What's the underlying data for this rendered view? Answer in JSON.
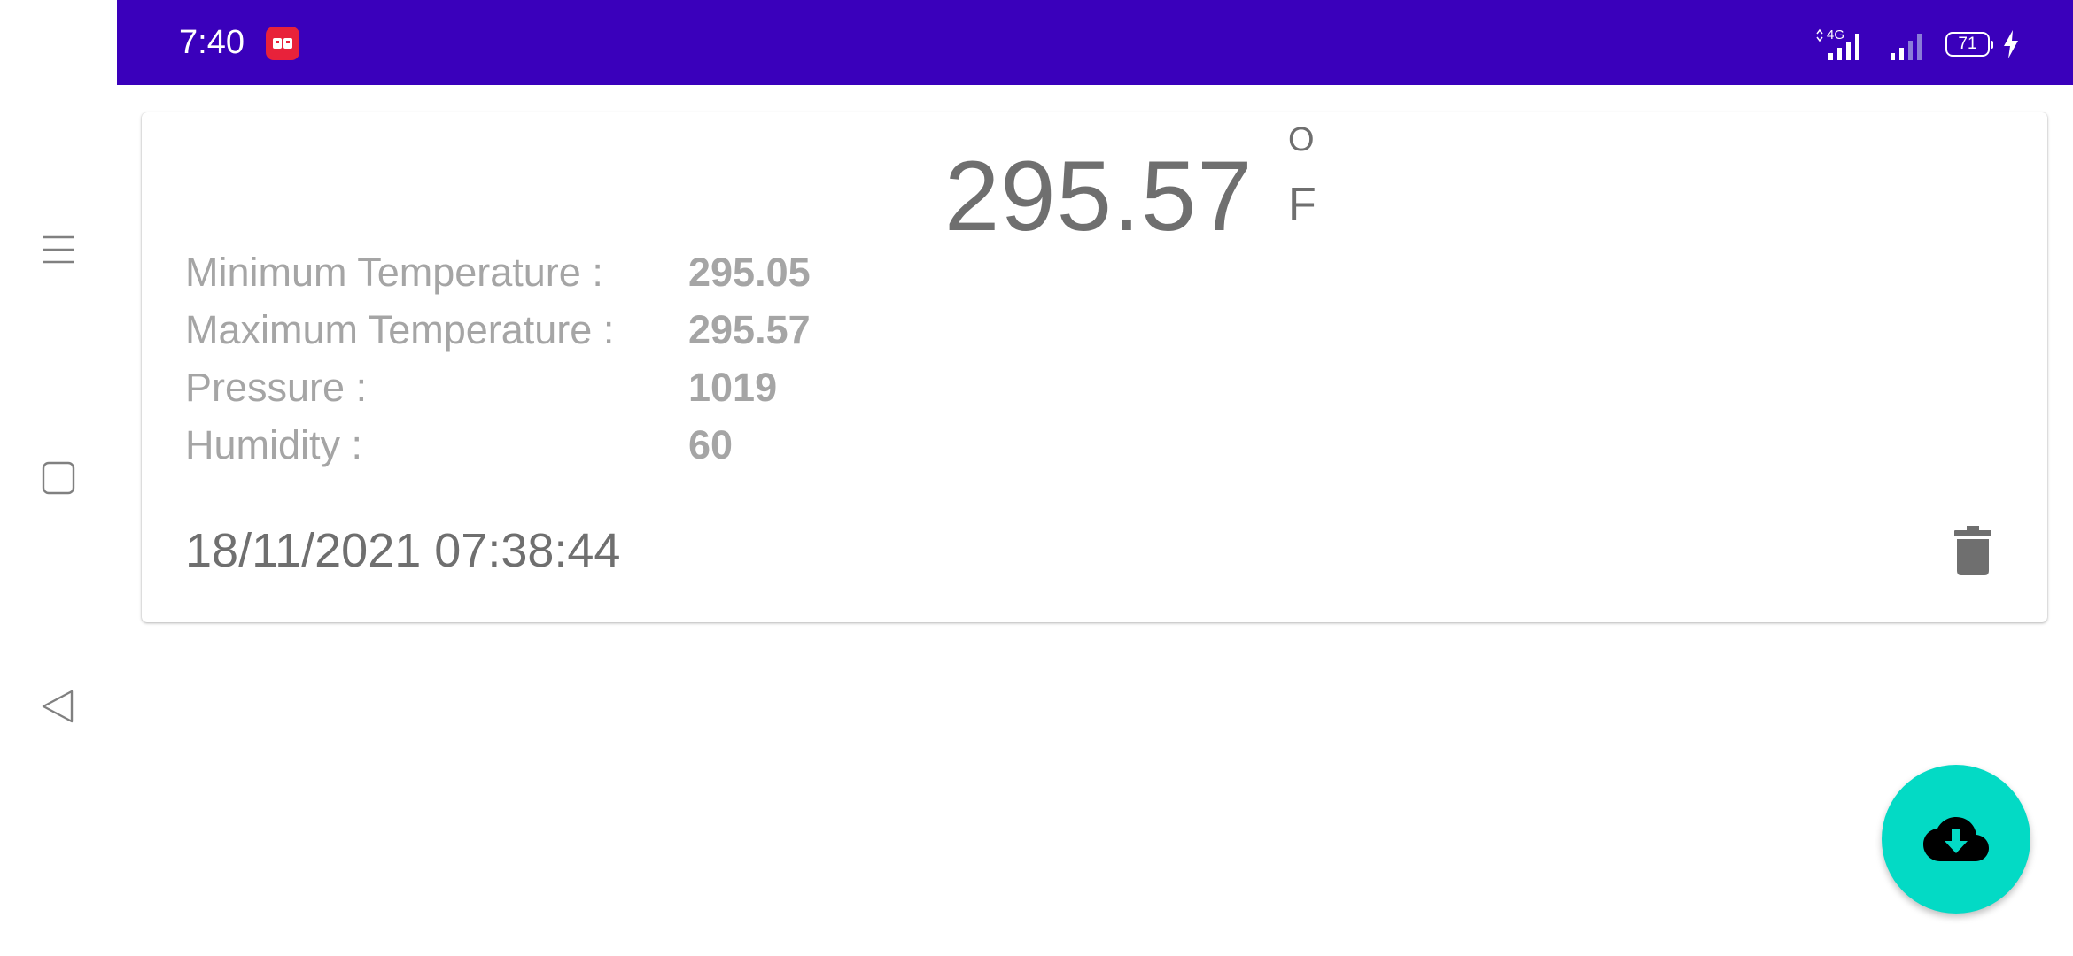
{
  "status_bar": {
    "time": "7:40",
    "app_icon": "rb-app-icon",
    "network_label": "4G",
    "battery_level": "71",
    "charging": true,
    "background_color": "#3a00bb"
  },
  "navigation": {
    "menu_icon": "menu-icon",
    "home_icon": "home-square-icon",
    "back_icon": "back-triangle-icon"
  },
  "weather_card": {
    "temperature": "295.57",
    "unit_degree": "O",
    "unit_letter": "F",
    "rows": [
      {
        "label": "Minimum Temperature :",
        "value": "295.05"
      },
      {
        "label": "Maximum Temperature :",
        "value": "295.57"
      },
      {
        "label": "Pressure :",
        "value": "1019"
      },
      {
        "label": "Humidity :",
        "value": "60"
      }
    ],
    "timestamp": "18/11/2021 07:38:44",
    "delete_icon": "trash-icon"
  },
  "fab": {
    "icon": "cloud-download-icon",
    "color": "#03dac5"
  }
}
